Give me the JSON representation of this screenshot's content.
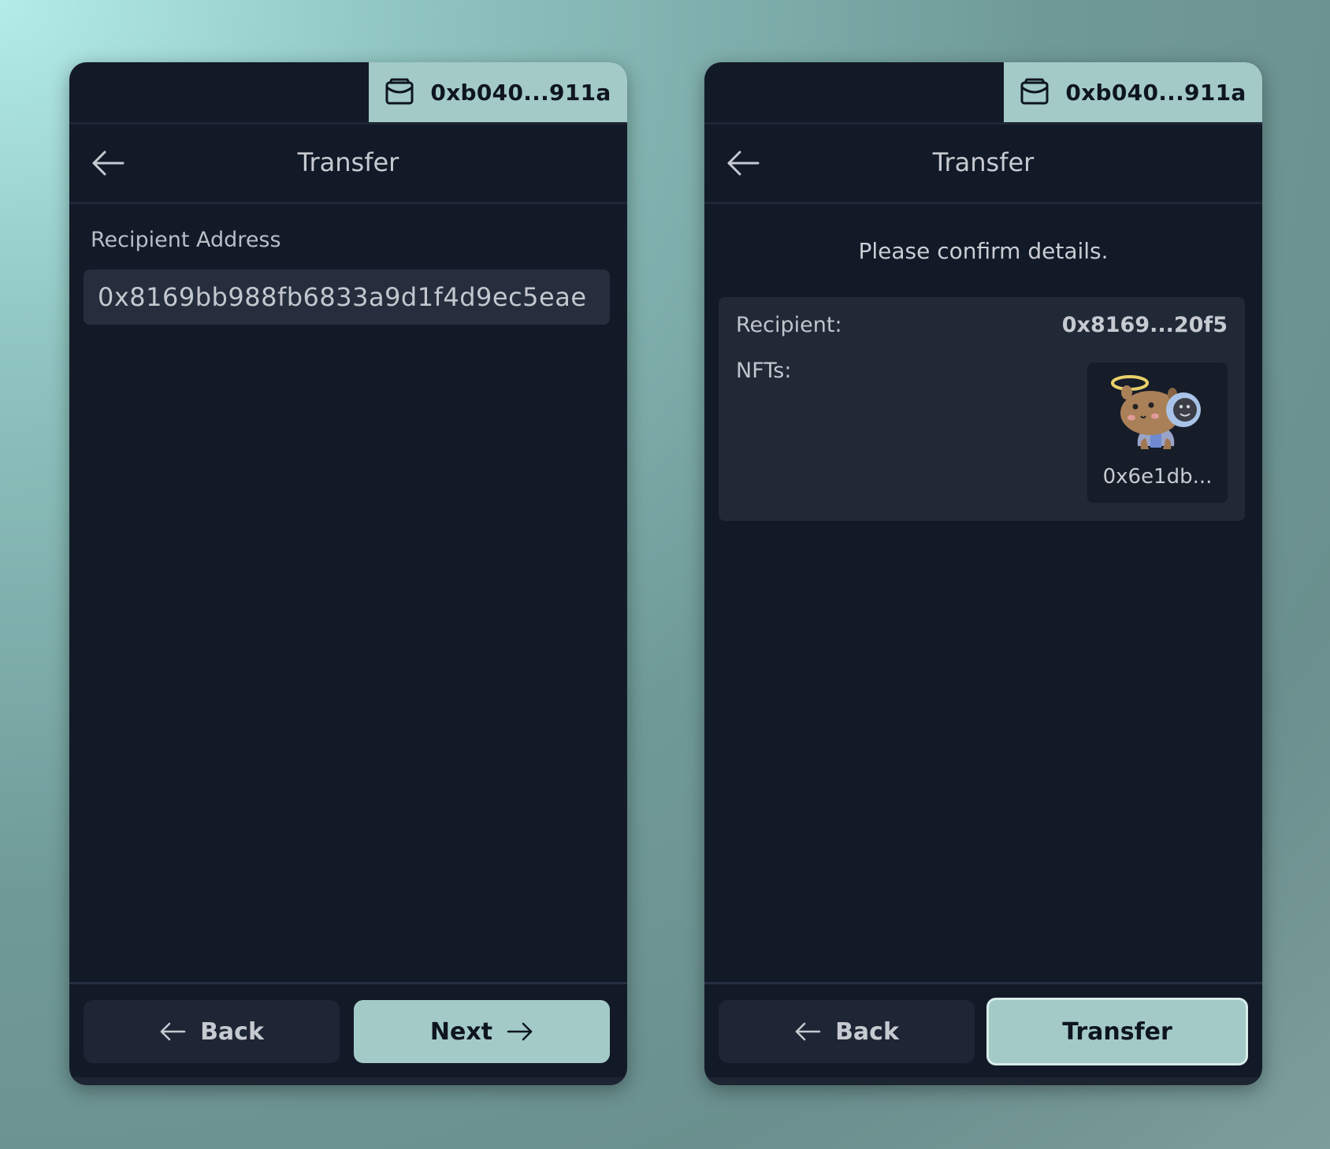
{
  "left_panel": {
    "wallet_address": "0xb040...911a",
    "header_title": "Transfer",
    "recipient_label": "Recipient Address",
    "recipient_value": "0x8169bb988fb6833a9d1f4d9ec5eae",
    "back_label": "Back",
    "next_label": "Next"
  },
  "right_panel": {
    "wallet_address": "0xb040...911a",
    "header_title": "Transfer",
    "confirm_text": "Please confirm details.",
    "recipient_label": "Recipient:",
    "recipient_value": "0x8169...20f5",
    "nfts_label": "NFTs:",
    "nft_name": "0x6e1db...",
    "back_label": "Back",
    "transfer_label": "Transfer"
  },
  "icons": {
    "wallet": "wallet-icon",
    "back_arrow": "arrow-left-icon",
    "next_arrow": "arrow-right-icon"
  },
  "colors": {
    "panel_bg": "#131a27",
    "accent": "#a3cac7"
  }
}
